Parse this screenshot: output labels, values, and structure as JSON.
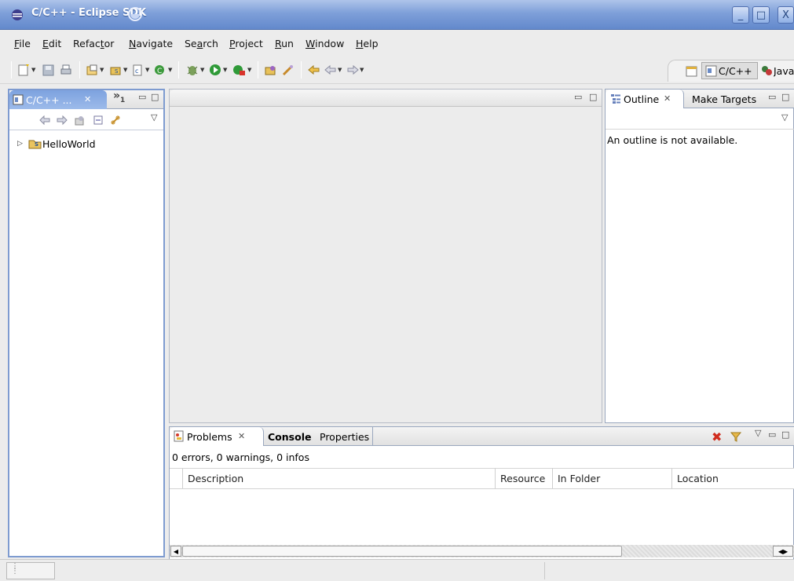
{
  "window": {
    "title": "C/C++ - Eclipse SDK",
    "controls": [
      "minimize",
      "maximize",
      "close"
    ]
  },
  "menu": {
    "items": [
      {
        "label": "File",
        "mnemonic": "F",
        "rest": "ile"
      },
      {
        "label": "Edit",
        "mnemonic": "E",
        "rest": "dit"
      },
      {
        "label": "Refactor",
        "pre": "Refac",
        "mnemonic": "t",
        "rest": "or"
      },
      {
        "label": "Navigate",
        "mnemonic": "N",
        "rest": "avigate"
      },
      {
        "label": "Search",
        "pre": "Se",
        "mnemonic": "a",
        "rest": "rch"
      },
      {
        "label": "Project",
        "mnemonic": "P",
        "rest": "roject"
      },
      {
        "label": "Run",
        "mnemonic": "R",
        "rest": "un"
      },
      {
        "label": "Window",
        "mnemonic": "W",
        "rest": "indow"
      },
      {
        "label": "Help",
        "mnemonic": "H",
        "rest": "elp"
      }
    ]
  },
  "perspectives": {
    "items": [
      "C/C++",
      "Java"
    ]
  },
  "projectExplorer": {
    "tab_label": "C/C++ ...",
    "overflow_label": "»",
    "overflow_count": "1",
    "tree": [
      {
        "label": "HelloWorld",
        "icon": "project-folder-icon"
      }
    ]
  },
  "outline": {
    "tabs": [
      {
        "label": "Outline",
        "active": true
      },
      {
        "label": "Make Targets",
        "active": false
      }
    ],
    "message": "An outline is not available."
  },
  "bottomPanel": {
    "tabs": [
      {
        "label": "Problems",
        "active": true
      },
      {
        "label": "Console",
        "bold": true
      },
      {
        "label": "Properties"
      }
    ],
    "summary": "0 errors, 0 warnings, 0 infos",
    "columns": [
      "Description",
      "Resource",
      "In Folder",
      "Location"
    ],
    "rows": []
  },
  "colors": {
    "titlebar": "#6389cc",
    "activeTab": "#7da2df",
    "panelBorder": "#9aa7be"
  }
}
